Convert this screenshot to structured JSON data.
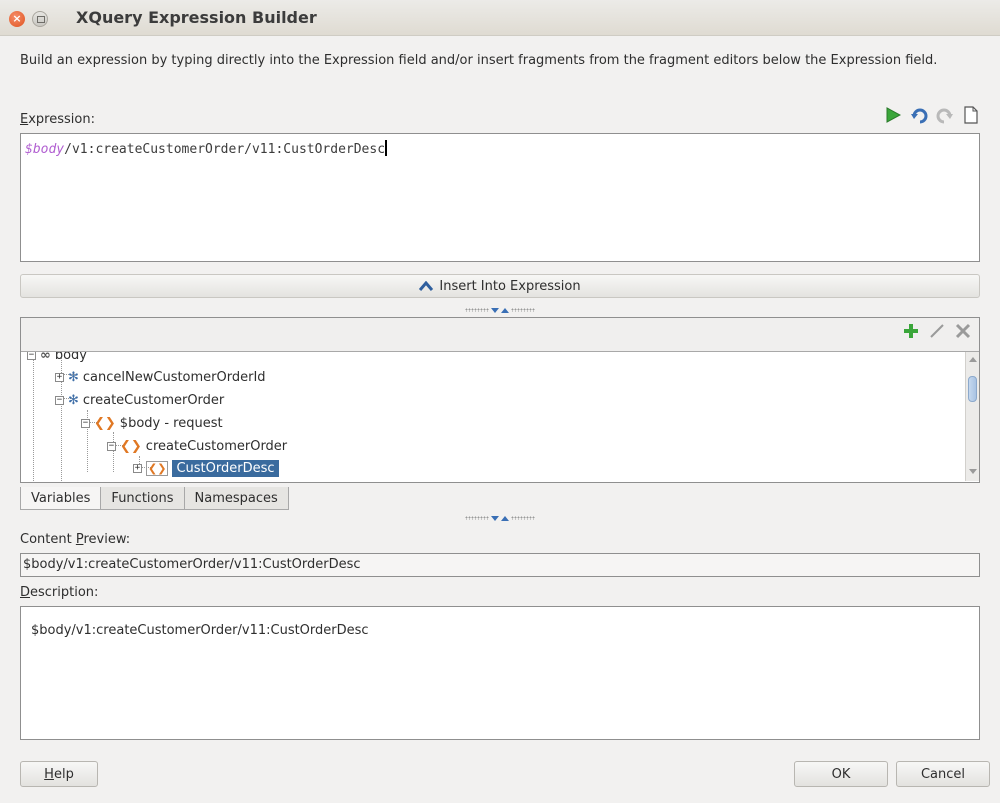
{
  "window": {
    "title": "XQuery Expression Builder"
  },
  "instructions": "Build an expression by typing directly into the Expression field and/or insert fragments from the fragment editors below the Expression field.",
  "expression": {
    "label_first": "E",
    "label_rest": "xpression:",
    "var_part": "$body",
    "path_part": "/v1:createCustomerOrder/v11:CustOrderDesc",
    "icons": [
      "run-icon",
      "undo-icon",
      "redo-icon",
      "clear-icon"
    ]
  },
  "insert_button": {
    "label": "Insert Into Expression"
  },
  "tree": {
    "toolbar_icons": [
      "add-icon",
      "edit-icon",
      "delete-icon"
    ],
    "rows": [
      {
        "label": "body",
        "expander": "−",
        "icon": "variable-icon"
      },
      {
        "label": "cancelNewCustomerOrderId",
        "expander": "+",
        "icon": "gear-icon"
      },
      {
        "label": "createCustomerOrder",
        "expander": "−",
        "icon": "gear-icon"
      },
      {
        "label": "$body - request",
        "expander": "−",
        "icon": "xml-element-icon"
      },
      {
        "label": "createCustomerOrder",
        "expander": "−",
        "icon": "xml-element-icon"
      },
      {
        "label": "CustOrderDesc",
        "expander": "+",
        "icon": "xml-element-icon",
        "selected": true
      }
    ]
  },
  "tabs": [
    {
      "label": "Variables",
      "active": true
    },
    {
      "label": "Functions",
      "active": false
    },
    {
      "label": "Namespaces",
      "active": false
    }
  ],
  "content_preview": {
    "label_a": "Content ",
    "label_u": "P",
    "label_b": "review:",
    "value": "$body/v1:createCustomerOrder/v11:CustOrderDesc"
  },
  "description": {
    "label_u": "D",
    "label_rest": "escription:",
    "value": "$body/v1:createCustomerOrder/v11:CustOrderDesc"
  },
  "buttons": {
    "help_u": "H",
    "help_rest": "elp",
    "ok": "OK",
    "cancel": "Cancel"
  },
  "colors": {
    "selection": "#3a6b9e",
    "variable_text": "#b15fd1",
    "run_icon": "#3aa63a"
  }
}
